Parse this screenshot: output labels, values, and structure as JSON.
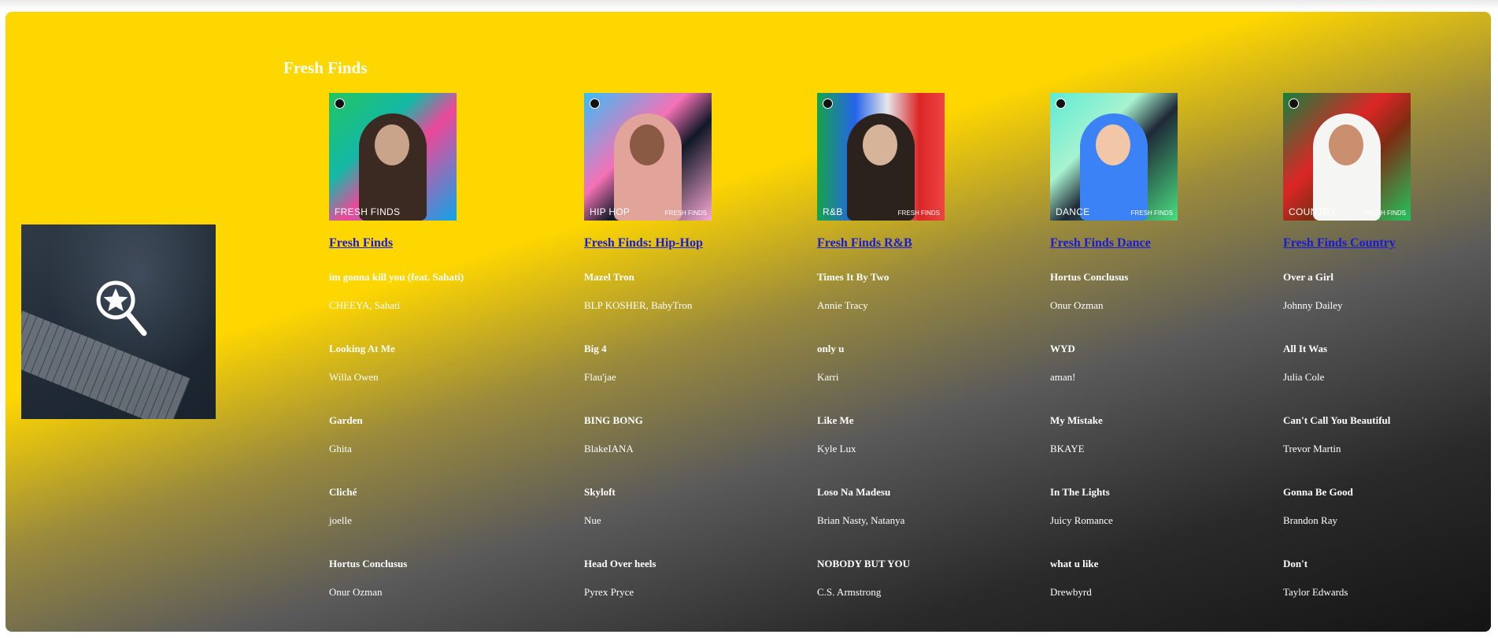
{
  "section": {
    "title": "Fresh Finds"
  },
  "colors": {
    "panel_top": "#ffd700",
    "panel_bottom": "#141414",
    "link": "#1a1ad8",
    "text": "#ffffff"
  },
  "hero": {
    "icon": "star-magnifier-icon"
  },
  "playlists": [
    {
      "title": "Fresh Finds",
      "cover": {
        "genre_label": "FRESH FINDS",
        "brand_label": ""
      },
      "tracks": [
        {
          "name": "im gonna kill you (feat. Sahati)",
          "artist": "CHEEYA, Sahati"
        },
        {
          "name": "Looking At Me",
          "artist": "Willa Owen"
        },
        {
          "name": "Garden",
          "artist": "Ghita"
        },
        {
          "name": "Cliché",
          "artist": "joelle"
        },
        {
          "name": "Hortus Conclusus",
          "artist": "Onur Ozman"
        }
      ]
    },
    {
      "title": "Fresh Finds: Hip-Hop",
      "cover": {
        "genre_label": "HIP HOP",
        "brand_label": "FRESH FINDS"
      },
      "tracks": [
        {
          "name": "Mazel Tron",
          "artist": "BLP KOSHER, BabyTron"
        },
        {
          "name": "Big 4",
          "artist": "Flau'jae"
        },
        {
          "name": "BING BONG",
          "artist": "BlakeIANA"
        },
        {
          "name": "Skyloft",
          "artist": "Nue"
        },
        {
          "name": "Head Over heels",
          "artist": "Pyrex Pryce"
        }
      ]
    },
    {
      "title": "Fresh Finds R&B",
      "cover": {
        "genre_label": "R&B",
        "brand_label": "FRESH FINDS"
      },
      "tracks": [
        {
          "name": "Times It By Two",
          "artist": "Annie Tracy"
        },
        {
          "name": "only u",
          "artist": "Karri"
        },
        {
          "name": "Like Me",
          "artist": "Kyle Lux"
        },
        {
          "name": "Loso Na Madesu",
          "artist": "Brian Nasty, Natanya"
        },
        {
          "name": "NOBODY BUT YOU",
          "artist": "C.S. Armstrong"
        }
      ]
    },
    {
      "title": "Fresh Finds Dance",
      "cover": {
        "genre_label": "DANCE",
        "brand_label": "FRESH FINDS"
      },
      "tracks": [
        {
          "name": "Hortus Conclusus",
          "artist": "Onur Ozman"
        },
        {
          "name": "WYD",
          "artist": "aman!"
        },
        {
          "name": "My Mistake",
          "artist": "BKAYE"
        },
        {
          "name": "In The Lights",
          "artist": "Juicy Romance"
        },
        {
          "name": "what u like",
          "artist": "Drewbyrd"
        }
      ]
    },
    {
      "title": "Fresh Finds Country",
      "cover": {
        "genre_label": "COUNTRY",
        "brand_label": "FRESH FINDS"
      },
      "tracks": [
        {
          "name": "Over a Girl",
          "artist": "Johnny Dailey"
        },
        {
          "name": "All It Was",
          "artist": "Julia Cole"
        },
        {
          "name": "Can't Call You Beautiful",
          "artist": "Trevor Martin"
        },
        {
          "name": "Gonna Be Good",
          "artist": "Brandon Ray"
        },
        {
          "name": "Don't",
          "artist": "Taylor Edwards"
        }
      ]
    }
  ]
}
